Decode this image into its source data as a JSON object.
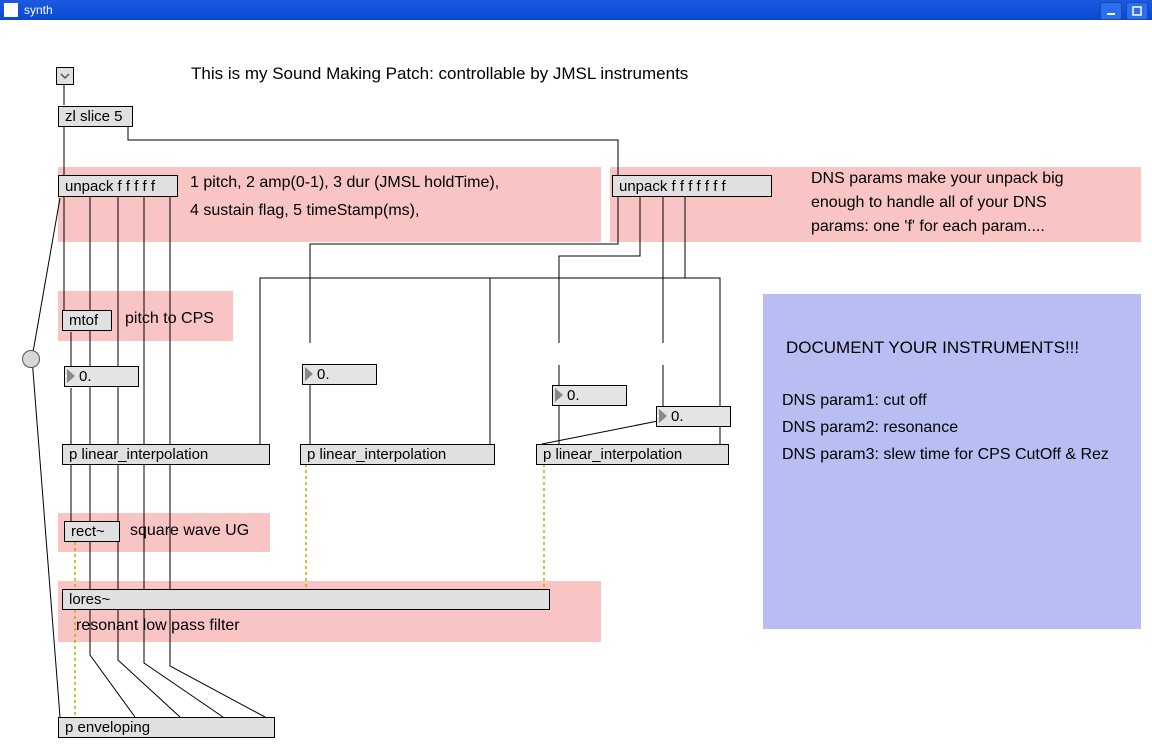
{
  "window": {
    "title": "synth"
  },
  "top_comment": "This is my Sound Making Patch: controllable by JMSL instruments",
  "objects": {
    "zl_slice": "zl slice 5",
    "unpack1": "unpack f f f f f",
    "unpack2": "unpack f f f f f f f",
    "mtof": "mtof",
    "rect": "rect~",
    "linear1": "p linear_interpolation",
    "linear2": "p linear_interpolation",
    "linear3": "p linear_interpolation",
    "lores": "lores~",
    "enveloping": "p enveloping"
  },
  "numbers": {
    "freq": "0.",
    "n1": "0.",
    "n2": "0.",
    "n3": "0."
  },
  "comments": {
    "unpack_desc_line1": "1 pitch, 2 amp(0-1), 3 dur (JMSL holdTime),",
    "unpack_desc_line2": "4 sustain flag, 5 timeStamp(ms),",
    "dns_note_line1": "DNS params make your unpack big",
    "dns_note_line2": "enough to handle all of your DNS",
    "dns_note_line3": "params: one 'f' for each param....",
    "mtof_c": "pitch to CPS",
    "rect_c": "square wave UG",
    "lores_c": "resonant low pass filter"
  },
  "purple": {
    "title": "DOCUMENT YOUR INSTRUMENTS!!!",
    "l1": "DNS param1: cut off",
    "l2": "DNS param2: resonance",
    "l3": "DNS param3: slew time for CPS CutOff & Rez"
  },
  "colors": {
    "pink": "#f8c4c4",
    "purple": "#b8bdf2",
    "titlebar_blue": "#1b5adf",
    "obj_bg": "#e0e0e0"
  }
}
